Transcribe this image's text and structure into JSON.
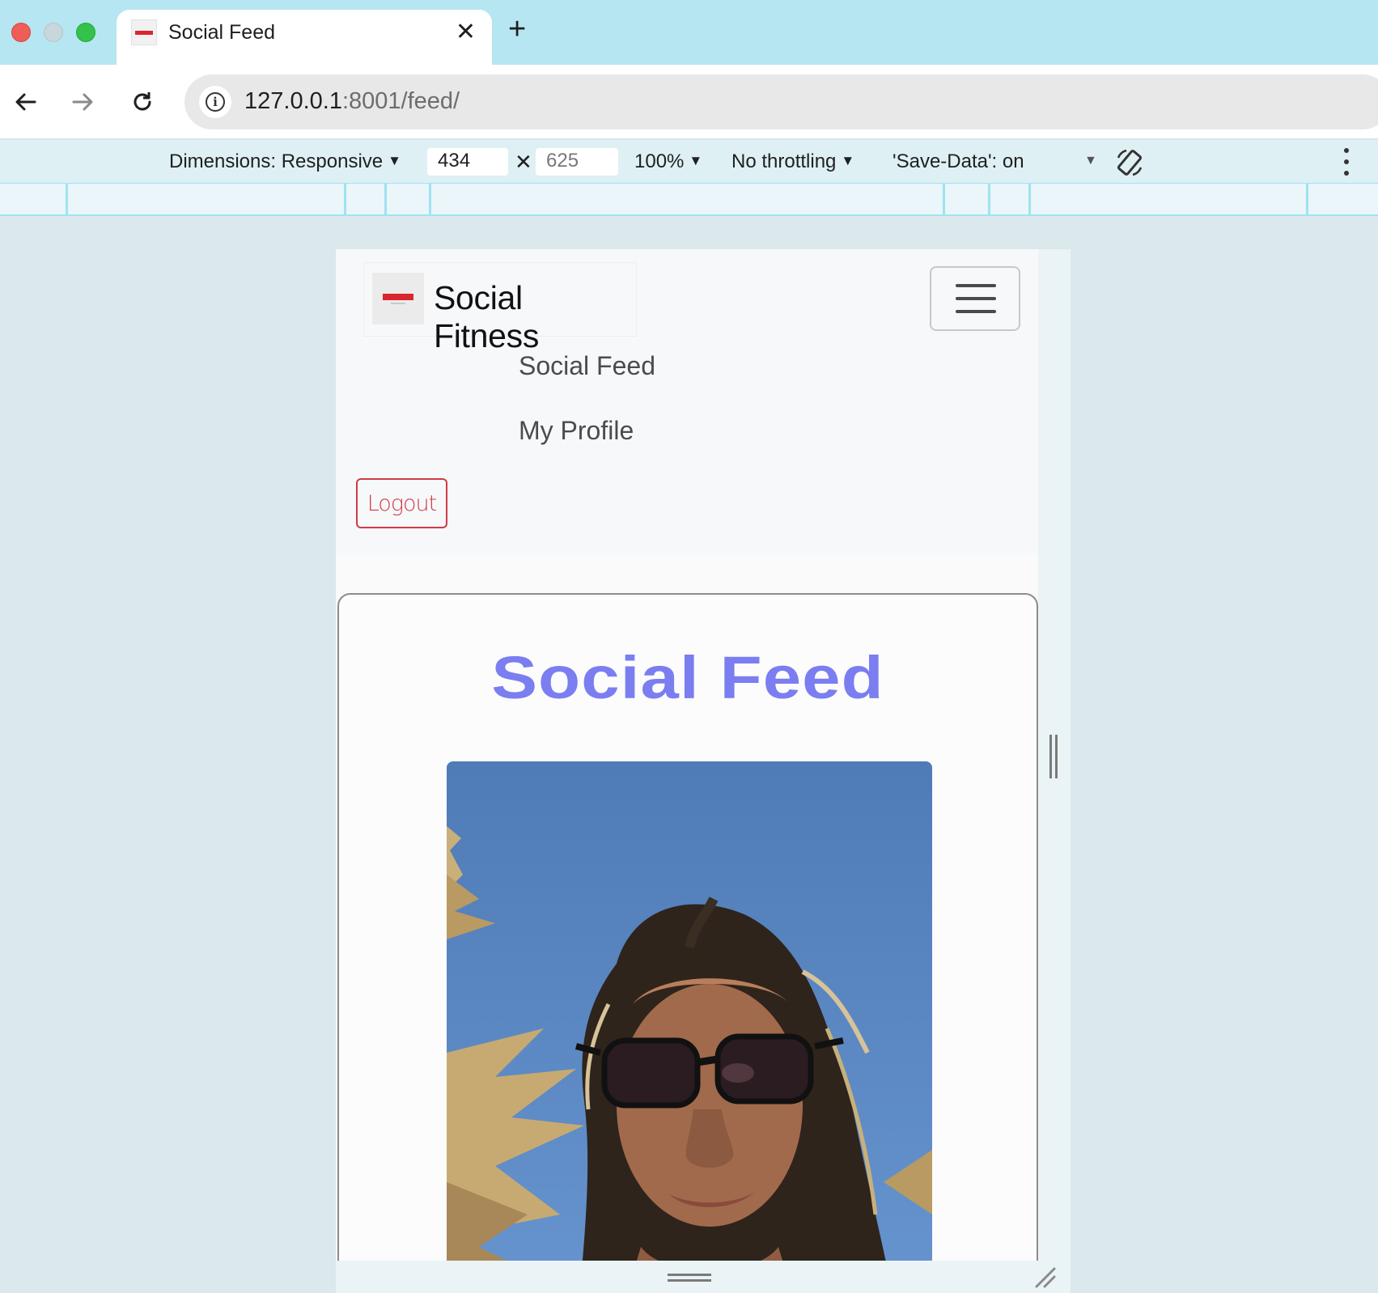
{
  "browser": {
    "tab": {
      "title": "Social Feed"
    },
    "address": {
      "host": "127.0.0.1",
      "path": ":8001/feed/"
    }
  },
  "devtools": {
    "dimensions_label": "Dimensions: Responsive",
    "width": "434",
    "height": "625",
    "zoom": "100%",
    "throttling": "No throttling",
    "save_data": "'Save-Data': on"
  },
  "page": {
    "brand": "Social Fitness",
    "nav": [
      "Social Feed",
      "My Profile"
    ],
    "logout_label": "Logout",
    "feed_title": "Social Feed",
    "colors": {
      "accent": "#7b7ef0",
      "logout": "#d23a47",
      "brand_red": "#d7262d"
    }
  }
}
